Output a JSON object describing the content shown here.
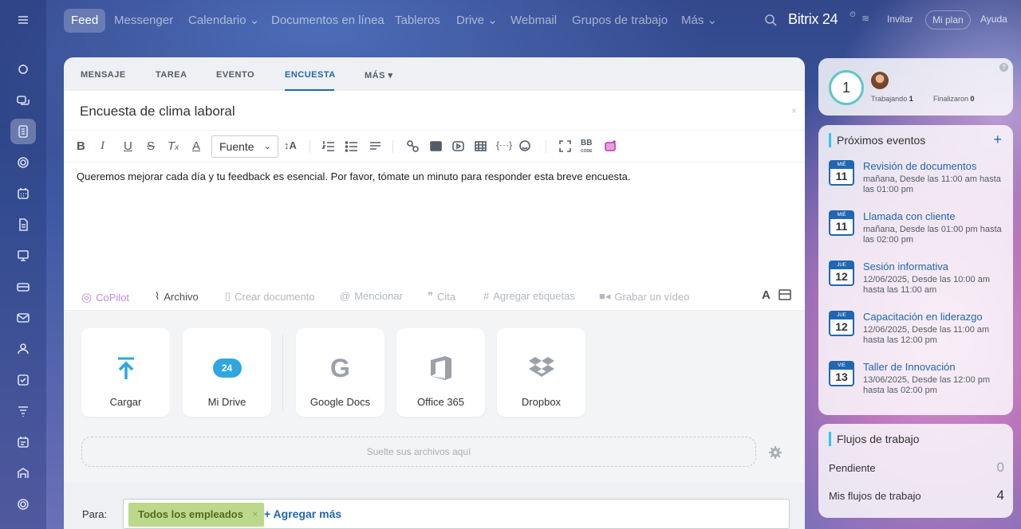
{
  "nav": {
    "items": [
      {
        "label": "Feed"
      },
      {
        "label": "Messenger"
      },
      {
        "label": "Calendario ⌄"
      },
      {
        "label": "Documentos en línea"
      },
      {
        "label": "Tableros"
      },
      {
        "label": "Drive ⌄"
      },
      {
        "label": "Webmail"
      },
      {
        "label": "Grupos de trabajo"
      },
      {
        "label": "Más ⌄"
      }
    ],
    "brand": "Bitrix 24",
    "invite": "Invitar",
    "plan": "Mi plan",
    "help": "Ayuda"
  },
  "composer": {
    "tabs": [
      "MENSAJE",
      "TAREA",
      "EVENTO",
      "ENCUESTA",
      "MÁS ▾"
    ],
    "title": "Encuesta de clima laboral",
    "font_select": "Fuente",
    "body": "Queremos mejorar cada día y tu feedback es esencial. Por favor, tómate un minuto para responder esta breve encuesta.",
    "attach_bar": {
      "copilot": "CoPilot",
      "file": "Archivo",
      "create_doc": "Crear documento",
      "mention": "Mencionar",
      "quote": "Cita",
      "tags": "Agregar etiquetas",
      "video": "Grabar un vídeo"
    },
    "upload_cards": [
      "Cargar",
      "Mi Drive",
      "Google Docs",
      "Office 365",
      "Dropbox"
    ],
    "drive_badge": "24",
    "dropzone": "Suelte sus archivos aquí",
    "to_label": "Para:",
    "chip": "Todos los empleados",
    "add_more": "+ Agregar más"
  },
  "status": {
    "count": "1",
    "working_label": "Trabajando",
    "working_value": "1",
    "finished_label": "Finalizaron",
    "finished_value": "0"
  },
  "events": {
    "title": "Próximos eventos",
    "items": [
      {
        "month": "MIÉ",
        "day": "11",
        "title": "Revisión de documentos",
        "time": "mañana, Desde las 11:00 am hasta las 01:00 pm"
      },
      {
        "month": "MIÉ",
        "day": "11",
        "title": "Llamada con cliente",
        "time": "mañana, Desde las 01:00 pm hasta las 02:00 pm"
      },
      {
        "month": "JUE",
        "day": "12",
        "title": "Sesión informativa",
        "time": "12/06/2025, Desde las 10:00 am hasta las 11:00 am"
      },
      {
        "month": "JUE",
        "day": "12",
        "title": "Capacitación en liderazgo",
        "time": "12/06/2025, Desde las 11:00 am hasta las 12:00 pm"
      },
      {
        "month": "VIE",
        "day": "13",
        "title": "Taller de Innovación",
        "time": "13/06/2025, Desde las 12:00 pm hasta las 02:00 pm"
      }
    ]
  },
  "workflows": {
    "title": "Flujos de trabajo",
    "pending_label": "Pendiente",
    "pending_value": "0",
    "mine_label": "Mis flujos de trabajo",
    "mine_value": "4"
  }
}
